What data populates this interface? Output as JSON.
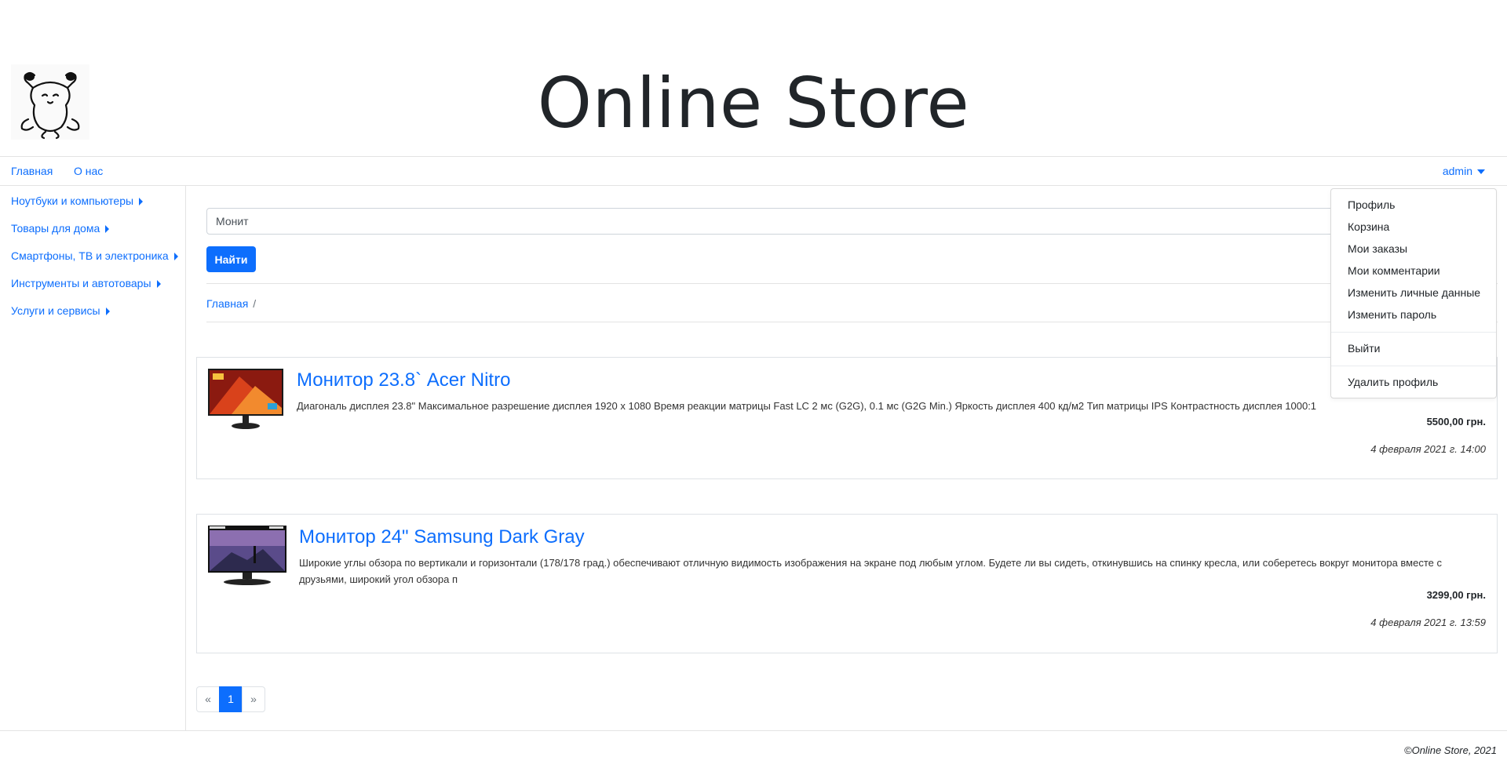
{
  "site": {
    "title": "Online Store"
  },
  "topnav": {
    "links": [
      "Главная",
      "О нас"
    ],
    "user": "admin"
  },
  "sidebar": {
    "items": [
      "Ноутбуки и компьютеры",
      "Товары для дома",
      "Смартфоны, ТВ и электроника",
      "Инструменты и автотовары",
      "Услуги и сервисы"
    ]
  },
  "search": {
    "value": "Монит",
    "button": "Найти"
  },
  "breadcrumb": {
    "home": "Главная",
    "separator": "/"
  },
  "products": [
    {
      "title": "Монитор 23.8` Acer Nitro",
      "description": "Диагональ дисплея 23.8\" Максимальное разрешение дисплея 1920 x 1080 Время реакции матрицы Fast LC 2 мс (G2G), 0.1 мс (G2G Min.) Яркость дисплея 400 кд/м2 Тип матрицы IPS Контрастность дисплея 1000:1",
      "price": "5500,00 грн.",
      "date": "4 февраля 2021 г. 14:00"
    },
    {
      "title": "Монитор 24\" Samsung Dark Gray",
      "description": "Широкие углы обзора по вертикали и горизонтали (178/178 град.) обеспечивают отличную видимость изображения на экране под любым углом. Будете ли вы сидеть, откинувшись на спинку кресла, или соберетесь вокруг монитора вместе с друзьями, широкий угол обзора п",
      "price": "3299,00 грн.",
      "date": "4 февраля 2021 г. 13:59"
    }
  ],
  "pagination": {
    "prev": "«",
    "current": "1",
    "next": "»"
  },
  "footer": {
    "text": "©Online Store, 2021"
  },
  "user_menu": {
    "items": [
      "Профиль",
      "Корзина",
      "Мои заказы",
      "Мои комментарии",
      "Изменить личные данные",
      "Изменить пароль"
    ],
    "logout": "Выйти",
    "delete": "Удалить профиль"
  },
  "colors": {
    "accent": "#0d6efd",
    "border": "#dee2e6"
  }
}
